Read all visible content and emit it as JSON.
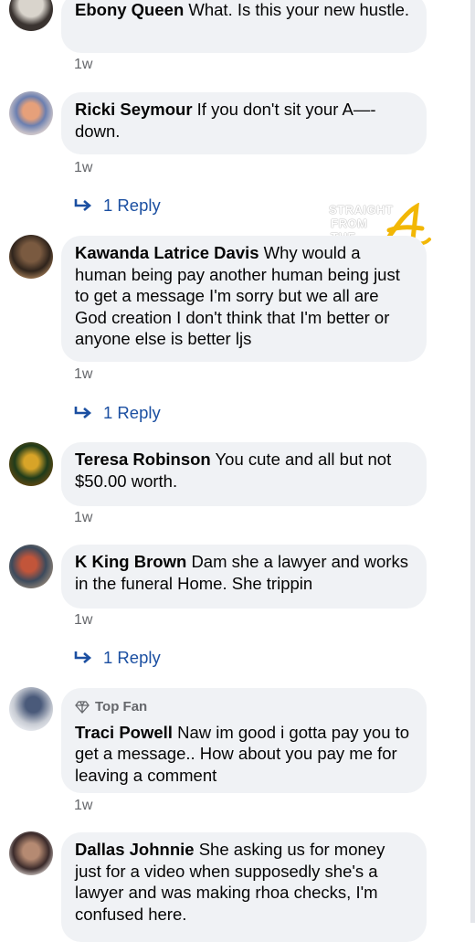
{
  "comments": [
    {
      "author": "Ebony Queen",
      "text": "What. Is this your new hustle.",
      "time": "1w"
    },
    {
      "author": "Ricki Seymour",
      "text": "If you don't sit your A—- down.",
      "time": "1w",
      "replies": "1 Reply"
    },
    {
      "author": "Kawanda Latrice Davis",
      "text": "Why would a human being pay another human being just to get a message I'm sorry but we all are God creation I don't think that I'm better or anyone else is better ljs",
      "time": "1w",
      "replies": "1 Reply"
    },
    {
      "author": "Teresa Robinson",
      "text": "You cute and all but not $50.00 worth.",
      "time": "1w"
    },
    {
      "author": "K King Brown",
      "text": "Dam she a lawyer and works in the funeral Home. She trippin",
      "time": "1w",
      "replies": "1 Reply"
    },
    {
      "badge": "Top Fan",
      "author": "Traci Powell",
      "text": "Naw im good i gotta pay you to get a message.. How about you pay me for leaving a comment",
      "time": "1w"
    },
    {
      "author": "Dallas Johnnie",
      "text": "She asking us for money just for a video when supposedly she's a lawyer and was making rhoa checks, I'm confused here."
    }
  ],
  "watermark": {
    "line1": "STRAIGHT",
    "line2": "FROM",
    "line3": "THE",
    "logo": "A"
  },
  "colors": {
    "bubble": "#f0f2f5",
    "link": "#1b4fa1",
    "meta": "#65676b",
    "watermark_accent": "#f2b705"
  },
  "icons": {
    "reply": "reply-arrow-icon",
    "badge": "diamond-icon"
  }
}
